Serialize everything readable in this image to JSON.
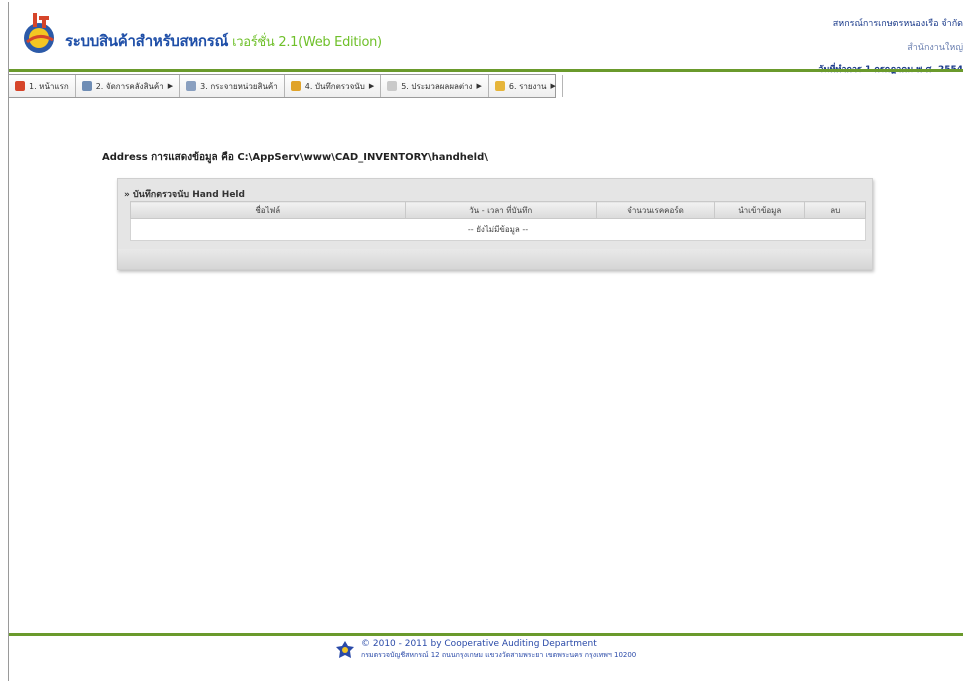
{
  "header": {
    "title_main": "ระบบสินค้าสำหรับสหกรณ์",
    "title_version": "เวอร์ชั่น 2.1(Web Edition)",
    "org_name": "สหกรณ์การเกษตรหนองเรือ จำกัด",
    "branch": "สำนักงานใหญ่",
    "work_date": "วันที่ทำการ 1 กรกฎาคม พ.ศ. 2554"
  },
  "menu": {
    "items": [
      {
        "label": "1. หน้าแรก",
        "icon_color": "#d6452a",
        "has_arrow": false
      },
      {
        "label": "2. จัดการคลังสินค้า",
        "icon_color": "#6f8db5",
        "has_arrow": true
      },
      {
        "label": "3. กระจายหน่วยสินค้า",
        "icon_color": "#8aa0c0",
        "has_arrow": false
      },
      {
        "label": "4. บันทึกตรวจนับ",
        "icon_color": "#e0a32a",
        "has_arrow": true
      },
      {
        "label": "5. ประมวลผลผลต่าง",
        "icon_color": "#c9c9c9",
        "has_arrow": true
      },
      {
        "label": "6. รายงาน",
        "icon_color": "#e6b53a",
        "has_arrow": true
      }
    ]
  },
  "content": {
    "address_text": "Address การแสดงข้อมูล คือ C:\\AppServ\\www\\CAD_INVENTORY\\handheld\\",
    "panel_title": "» บันทึกตรวจนับ Hand Held",
    "table": {
      "columns": [
        "ชื่อไฟล์",
        "วัน - เวลา ที่บันทึก",
        "จำนวนเรคคอร์ด",
        "นำเข้าข้อมูล",
        "ลบ"
      ],
      "empty_message": "-- ยังไม่มีข้อมูล --"
    }
  },
  "footer": {
    "copyright": "© 2010 - 2011  by Cooperative Auditing Department",
    "address": "กรมตรวจบัญชีสหกรณ์ 12 ถนนกรุงเกษม แขวงวัดสามพระยา เขตพระนคร กรุงเทพฯ 10200"
  },
  "colors": {
    "brand_blue": "#1f4fa8",
    "version_green": "#6fc02a",
    "rule_green": "#6a9a2c"
  }
}
